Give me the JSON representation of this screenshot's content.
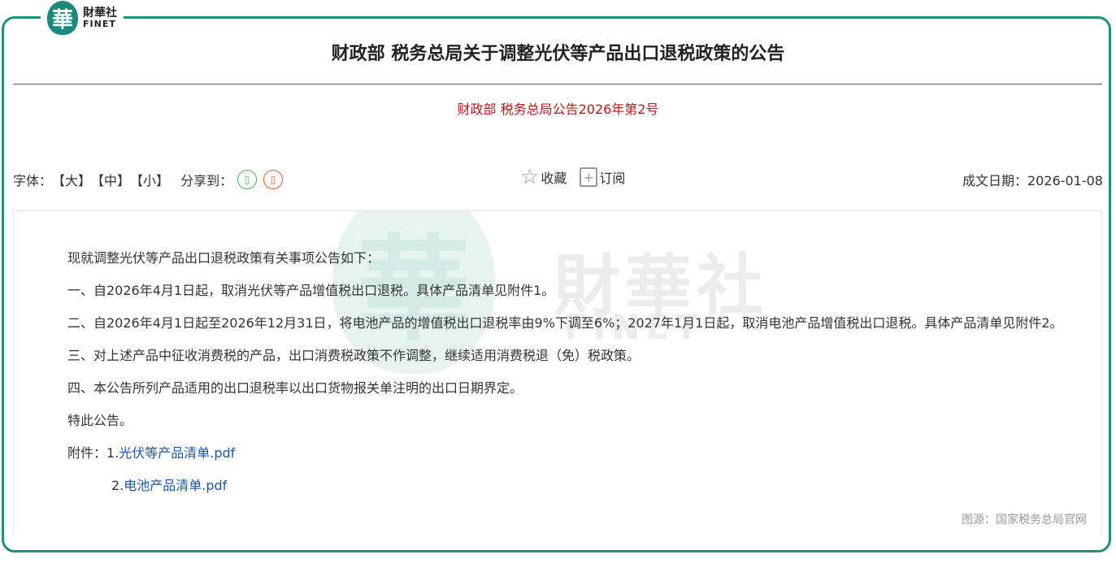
{
  "brand": {
    "badge": "華",
    "name_cn": "財華社",
    "name_en": "FINET",
    "accent": "#1f8f7f"
  },
  "article": {
    "title": "财政部 税务总局关于调整光伏等产品出口退税政策的公告",
    "subtitle": "财政部 税务总局公告2026年第2号",
    "subtitle_color": "#c0161b"
  },
  "toolbar": {
    "font_label": "字体：",
    "font_large": "【大】",
    "font_medium": "【中】",
    "font_small": "【小】",
    "share_label": "分享到：",
    "share_wechat_icon": "wechat-icon",
    "share_weibo_icon": "weibo-icon",
    "favorite_label": "收藏",
    "subscribe_label": "订阅",
    "date_label": "成文日期：2026-01-08"
  },
  "watermark": {
    "badge": "華",
    "cn": "財華社",
    "en": "FINET"
  },
  "content": {
    "paragraphs": [
      "现就调整光伏等产品出口退税政策有关事项公告如下：",
      "一、自2026年4月1日起，取消光伏等产品增值税出口退税。具体产品清单见附件1。",
      "二、自2026年4月1日起至2026年12月31日，将电池产品的增值税出口退税率由9%下调至6%；2027年1月1日起，取消电池产品增值税出口退税。具体产品清单见附件2。",
      "三、对上述产品中征收消费税的产品，出口消费税政策不作调整，继续适用消费税退（免）税政策。",
      "四、本公告所列产品适用的出口退税率以出口货物报关单注明的出口日期界定。",
      "特此公告。"
    ],
    "attachments_label": "附件：",
    "attachment1_index": "1.",
    "attachment1": "光伏等产品清单.pdf",
    "attachment2_index": "2.",
    "attachment2": "电池产品清单.pdf",
    "source": "图源：国家税务总局官网"
  }
}
